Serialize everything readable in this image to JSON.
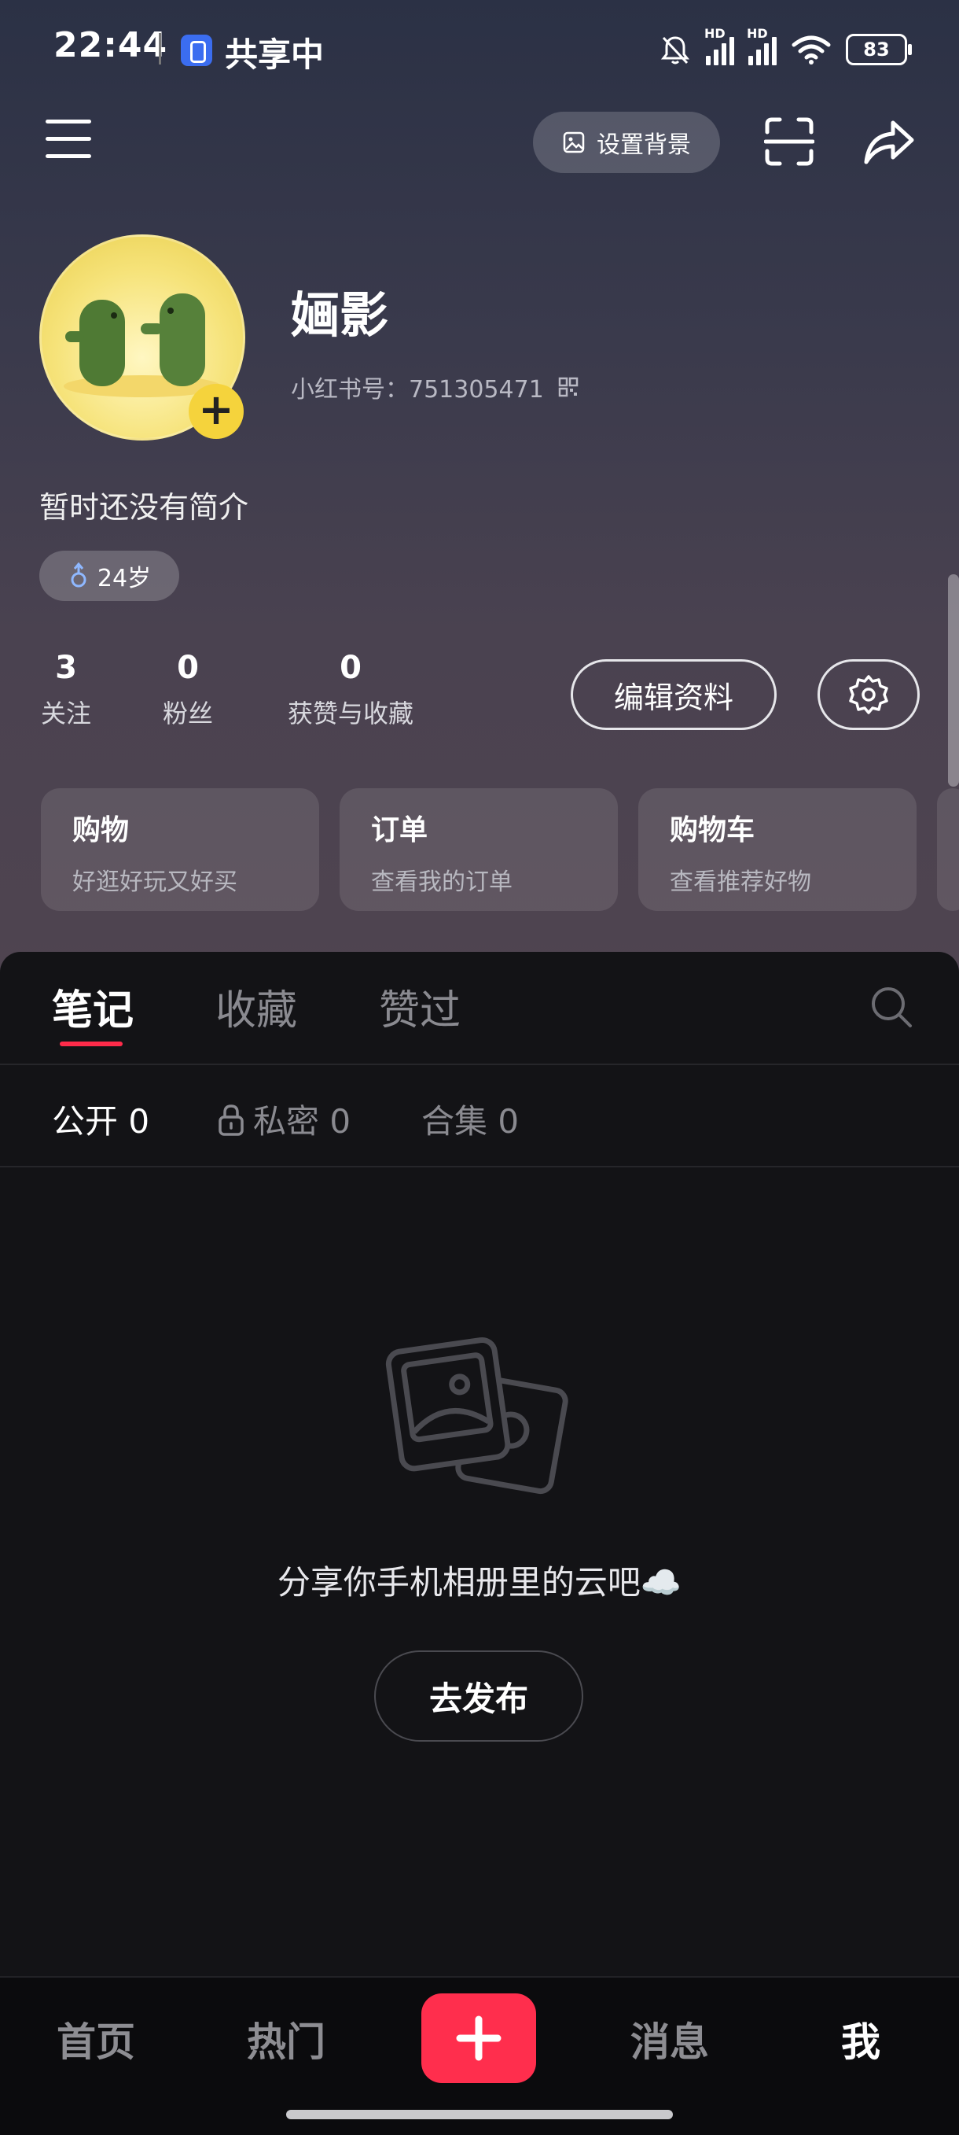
{
  "status_bar": {
    "time": "22:44",
    "sharing_label": "共享中",
    "hd1": "HD",
    "hd2": "HD",
    "battery": "83"
  },
  "top_nav": {
    "set_background_label": "设置背景"
  },
  "profile": {
    "username": "婳影",
    "id_label": "小红书号：751305471",
    "bio": "暂时还没有简介",
    "age": "24岁",
    "stats": [
      {
        "value": "3",
        "label": "关注"
      },
      {
        "value": "0",
        "label": "粉丝"
      },
      {
        "value": "0",
        "label": "获赞与收藏"
      }
    ],
    "edit_label": "编辑资料"
  },
  "cards": [
    {
      "title": "购物",
      "subtitle": "好逛好玩又好买"
    },
    {
      "title": "订单",
      "subtitle": "查看我的订单"
    },
    {
      "title": "购物车",
      "subtitle": "查看推荐好物"
    }
  ],
  "tabs": [
    {
      "label": "笔记"
    },
    {
      "label": "收藏"
    },
    {
      "label": "赞过"
    }
  ],
  "subtabs": [
    {
      "label": "公开 0"
    },
    {
      "label": "私密 0"
    },
    {
      "label": "合集 0"
    }
  ],
  "empty_state": {
    "text": "分享你手机相册里的云吧☁️",
    "button_label": "去发布"
  },
  "bottom_nav": {
    "items": [
      {
        "label": "首页"
      },
      {
        "label": "热门"
      },
      {
        "label": "消息"
      },
      {
        "label": "我"
      }
    ]
  },
  "colors": {
    "accent": "#ff2e4d",
    "avatar_badge": "#f5d33c"
  }
}
